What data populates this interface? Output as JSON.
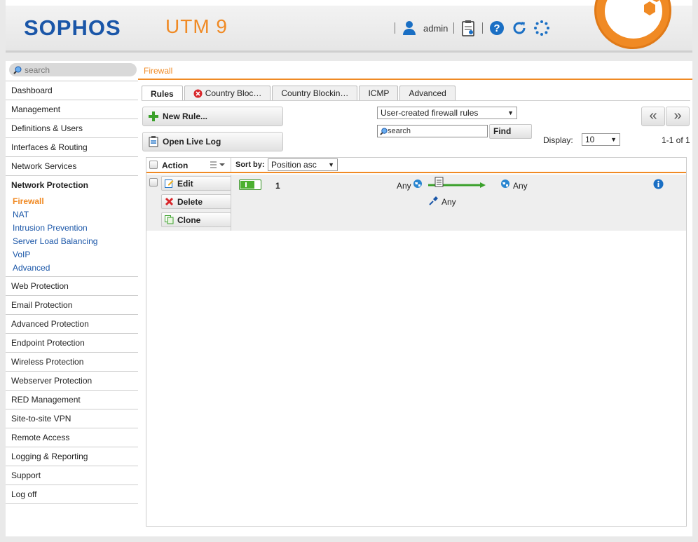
{
  "header": {
    "brand": "SOPHOS",
    "product": "UTM 9",
    "user": "admin",
    "icons": [
      "user-icon",
      "clipboard-icon",
      "help-icon",
      "refresh-icon",
      "spinner-icon"
    ]
  },
  "sidebar": {
    "search_placeholder": "search",
    "items_top": [
      "Dashboard",
      "Management",
      "Definitions & Users",
      "Interfaces & Routing",
      "Network Services"
    ],
    "section": "Network Protection",
    "subitems": [
      "Firewall",
      "NAT",
      "Intrusion Prevention",
      "Server Load Balancing",
      "VoIP",
      "Advanced"
    ],
    "items_bottom": [
      "Web Protection",
      "Email Protection",
      "Advanced Protection",
      "Endpoint Protection",
      "Wireless Protection",
      "Webserver Protection",
      "RED Management",
      "Site-to-site VPN",
      "Remote Access",
      "Logging & Reporting",
      "Support",
      "Log off"
    ]
  },
  "main": {
    "breadcrumb": "Firewall",
    "tabs": [
      "Rules",
      "Country Bloc…",
      "Country Blockin…",
      "ICMP",
      "Advanced"
    ],
    "new_rule": "New Rule...",
    "open_live_log": "Open Live Log",
    "filter_select": "User-created firewall rules",
    "search_placeholder": "search",
    "find": "Find",
    "display_label": "Display:",
    "display_value": "10",
    "pager_prev": "«",
    "pager_next": "»",
    "range": "1-1 of 1",
    "list": {
      "action_header": "Action",
      "sort_label": "Sort by:",
      "sort_value": "Position asc",
      "row": {
        "edit": "Edit",
        "delete": "Delete",
        "clone": "Clone",
        "number": "1",
        "source": "Any",
        "destination": "Any",
        "service": "Any",
        "enabled": true
      }
    }
  },
  "colors": {
    "brand_blue": "#1a56a8",
    "accent_orange": "#f08a24",
    "toggle_green": "#4cb030"
  }
}
